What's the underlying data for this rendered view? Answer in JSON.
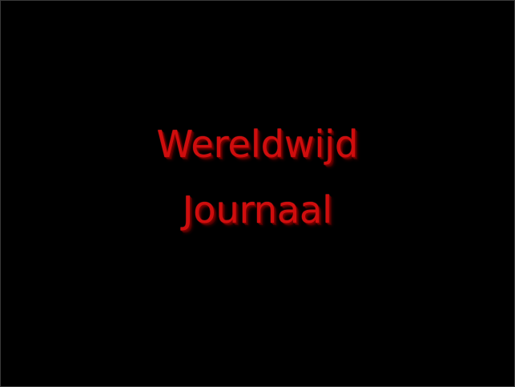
{
  "slide": {
    "title_lines": [
      "Wereldwijd",
      "Journaal"
    ],
    "colors": {
      "background": "#000000",
      "title": "#d00d0d"
    }
  }
}
